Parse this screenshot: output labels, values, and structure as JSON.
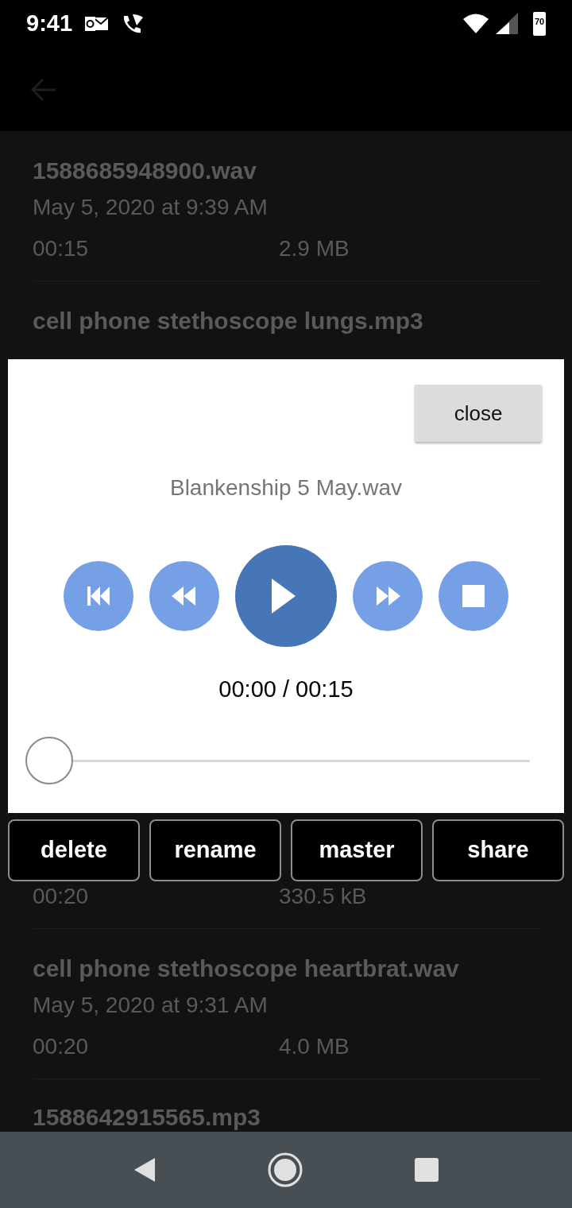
{
  "status_bar": {
    "time": "9:41",
    "battery": "70"
  },
  "recordings_top": [
    {
      "title": "1588685948900.wav",
      "date": "May 5, 2020 at 9:39 AM",
      "duration": "00:15",
      "size": "2.9 MB"
    },
    {
      "title": "cell phone stethoscope lungs.mp3"
    }
  ],
  "recordings_bottom": [
    {
      "duration": "00:20",
      "size": "330.5 kB"
    },
    {
      "title": "cell phone stethoscope heartbrat.wav",
      "date": "May 5, 2020 at 9:31 AM",
      "duration": "00:20",
      "size": "4.0 MB"
    },
    {
      "title": "1588642915565.mp3"
    }
  ],
  "player": {
    "close": "close",
    "file_name": "Blankenship 5 May.wav",
    "controls": [
      {
        "kind": "skip_back"
      },
      {
        "kind": "rewind"
      },
      {
        "kind": "play"
      },
      {
        "kind": "fast_forward"
      },
      {
        "kind": "stop"
      }
    ],
    "time": "00:00 / 00:15",
    "level": 0
  },
  "actions": [
    "delete",
    "rename",
    "master",
    "share"
  ]
}
